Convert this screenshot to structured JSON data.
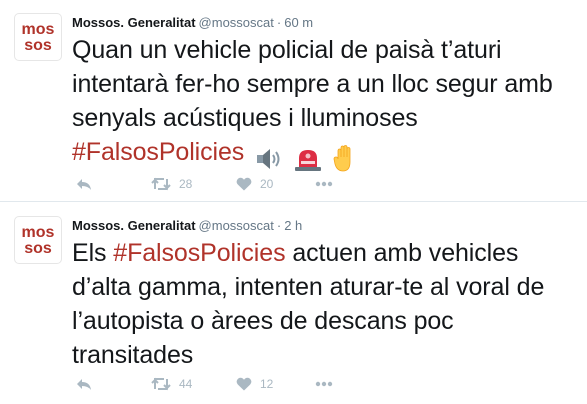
{
  "tweets": [
    {
      "author_name": "Mossos. Generalitat",
      "handle": "@mossoscat",
      "separator": "·",
      "time": "60 m",
      "text_before": "Quan un vehicle policial de paisà t’aturi intentarà fer-ho sempre a un lloc segur amb senyals acústiques i lluminoses ",
      "hashtag": "#FalsosPolicies",
      "text_after": "",
      "emojis": [
        "speaker-icon",
        "police-light-icon",
        "raised-hand-icon"
      ],
      "retweets": "28",
      "likes": "20"
    },
    {
      "author_name": "Mossos. Generalitat",
      "handle": "@mossoscat",
      "separator": "·",
      "time": "2 h",
      "text_before": "Els ",
      "hashtag": "#FalsosPolicies",
      "text_after": " actuen amb vehicles d’alta gamma, intenten aturar-te al voral de l’autopista o àrees de descans poc transitades",
      "emojis": [],
      "retweets": "44",
      "likes": "12"
    }
  ],
  "avatar": {
    "line1": "mos",
    "line2": "sos"
  },
  "colors": {
    "brand_red": "#b0332a",
    "hashtag": "#b0332a",
    "meta_gray": "#657786",
    "icon_gray": "#aab8c2",
    "divider": "#e1e8ed"
  }
}
